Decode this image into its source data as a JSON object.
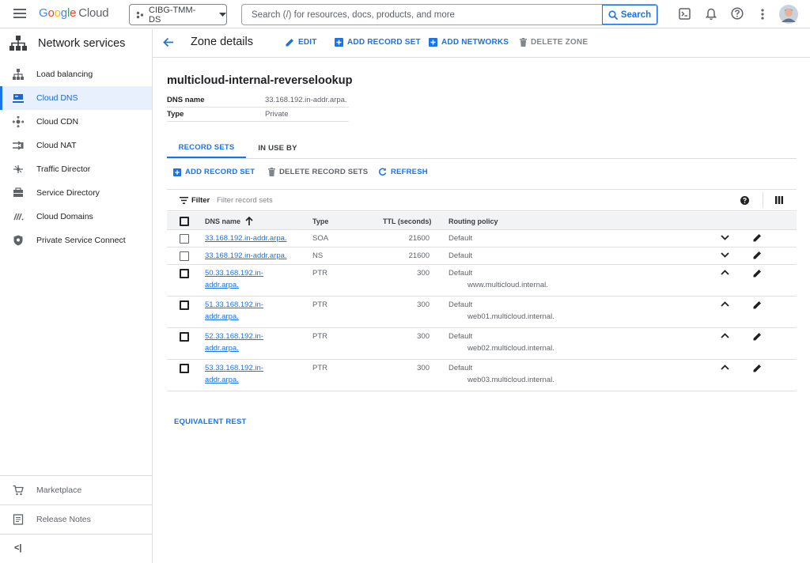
{
  "topbar": {
    "logo": {
      "g": "G",
      "o1": "o",
      "o2": "o",
      "g2": "g",
      "l": "l",
      "e": "e",
      "cloud": "Cloud"
    },
    "project": "CIBG-TMM-DS",
    "search_placeholder": "Search (/) for resources, docs, products, and more",
    "search_button": "Search"
  },
  "sidebar": {
    "title": "Network services",
    "items": [
      {
        "label": "Load balancing",
        "icon": "load-balancing-icon"
      },
      {
        "label": "Cloud DNS",
        "icon": "cloud-dns-icon",
        "active": true
      },
      {
        "label": "Cloud CDN",
        "icon": "cloud-cdn-icon"
      },
      {
        "label": "Cloud NAT",
        "icon": "cloud-nat-icon"
      },
      {
        "label": "Traffic Director",
        "icon": "traffic-director-icon"
      },
      {
        "label": "Service Directory",
        "icon": "service-directory-icon"
      },
      {
        "label": "Cloud Domains",
        "icon": "cloud-domains-icon"
      },
      {
        "label": "Private Service Connect",
        "icon": "shield-icon"
      }
    ],
    "marketplace": "Marketplace",
    "release_notes": "Release Notes",
    "collapse": "<|"
  },
  "header": {
    "title": "Zone details",
    "edit": "EDIT",
    "add_record_set": "ADD RECORD SET",
    "add_networks": "ADD NETWORKS",
    "delete_zone": "DELETE ZONE"
  },
  "zone": {
    "name": "multicloud-internal-reverselookup",
    "dns_name_label": "DNS name",
    "dns_name_value": "33.168.192.in-addr.arpa.",
    "type_label": "Type",
    "type_value": "Private"
  },
  "tabs": {
    "record_sets": "RECORD SETS",
    "in_use_by": "IN USE BY"
  },
  "actions": {
    "add_record_set": "ADD RECORD SET",
    "delete_record_sets": "DELETE RECORD SETS",
    "refresh": "REFRESH"
  },
  "filter": {
    "label": "Filter",
    "placeholder": "Filter record sets"
  },
  "table": {
    "headers": {
      "dns_name": "DNS name",
      "type": "Type",
      "ttl": "TTL (seconds)",
      "routing": "Routing policy"
    },
    "rows": [
      {
        "name1": "33.168.192.in-addr.arpa.",
        "name2": "",
        "type": "SOA",
        "ttl": "21600",
        "routing": "Default",
        "data": "",
        "expanded": false
      },
      {
        "name1": "33.168.192.in-addr.arpa.",
        "name2": "",
        "type": "NS",
        "ttl": "21600",
        "routing": "Default",
        "data": "",
        "expanded": false
      },
      {
        "name1": "50.33.168.192.in-",
        "name2": "addr.arpa.",
        "type": "PTR",
        "ttl": "300",
        "routing": "Default",
        "data": "www.multicloud.internal.",
        "expanded": true
      },
      {
        "name1": "51.33.168.192.in-",
        "name2": "addr.arpa.",
        "type": "PTR",
        "ttl": "300",
        "routing": "Default",
        "data": "web01.multicloud.internal.",
        "expanded": true
      },
      {
        "name1": "52.33.168.192.in-",
        "name2": "addr.arpa.",
        "type": "PTR",
        "ttl": "300",
        "routing": "Default",
        "data": "web02.multicloud.internal.",
        "expanded": true
      },
      {
        "name1": "53.33.168.192.in-",
        "name2": "addr.arpa.",
        "type": "PTR",
        "ttl": "300",
        "routing": "Default",
        "data": "web03.multicloud.internal.",
        "expanded": true
      }
    ]
  },
  "equivalent_rest": "EQUIVALENT REST"
}
